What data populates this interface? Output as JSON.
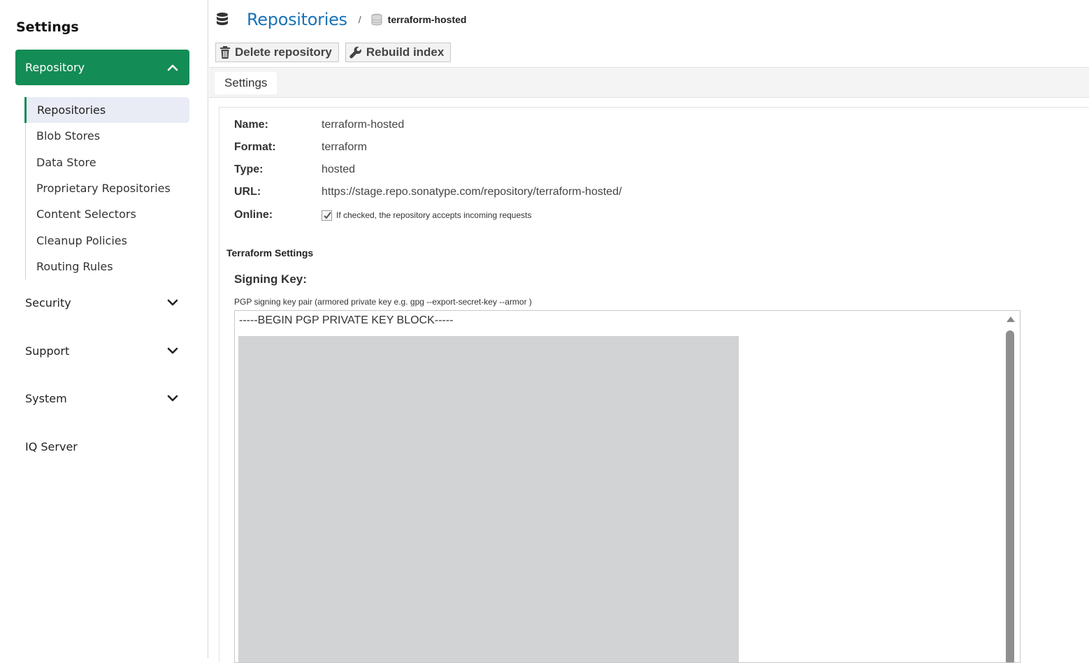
{
  "sidebar": {
    "title": "Settings",
    "active_group": {
      "label": "Repository"
    },
    "items": [
      {
        "label": "Repositories",
        "selected": true
      },
      {
        "label": "Blob Stores"
      },
      {
        "label": "Data Store"
      },
      {
        "label": "Proprietary Repositories"
      },
      {
        "label": "Content Selectors"
      },
      {
        "label": "Cleanup Policies"
      },
      {
        "label": "Routing Rules"
      }
    ],
    "groups": [
      {
        "label": "Security"
      },
      {
        "label": "Support"
      },
      {
        "label": "System"
      },
      {
        "label": "IQ Server"
      }
    ],
    "accent_color": "#148c55"
  },
  "header": {
    "title": "Repositories",
    "separator": "/",
    "current": "terraform-hosted"
  },
  "toolbar": {
    "delete_label": "Delete repository",
    "rebuild_label": "Rebuild index"
  },
  "tabs": [
    {
      "label": "Settings"
    }
  ],
  "details": {
    "name_label": "Name:",
    "name_value": "terraform-hosted",
    "format_label": "Format:",
    "format_value": "terraform",
    "type_label": "Type:",
    "type_value": "hosted",
    "url_label": "URL:",
    "url_value": "https://stage.repo.sonatype.com/repository/terraform-hosted/",
    "online_label": "Online:",
    "online_checked": true,
    "online_hint": "If checked, the repository accepts incoming requests"
  },
  "terraform": {
    "section_title": "Terraform Settings",
    "signing_label": "Signing Key:",
    "signing_hint": "PGP signing key pair (armored private key e.g. gpg --export-secret-key --armor )",
    "key_first_line": "-----BEGIN PGP PRIVATE KEY BLOCK-----"
  }
}
